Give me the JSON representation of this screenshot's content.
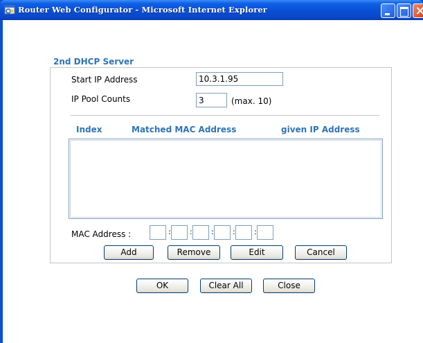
{
  "window": {
    "title": "Router Web Configurator - Microsoft Internet Explorer"
  },
  "section": {
    "title": "2nd DHCP Server"
  },
  "start_ip": {
    "label": "Start IP Address",
    "value": "10.3.1.95"
  },
  "ip_pool": {
    "label": "IP Pool Counts",
    "value": "3",
    "hint": "(max. 10)"
  },
  "table": {
    "columns": [
      "Index",
      "Matched MAC Address",
      "given IP Address"
    ],
    "rows": []
  },
  "mac_address": {
    "label": "MAC Address :",
    "octets": [
      "",
      "",
      "",
      "",
      "",
      ""
    ]
  },
  "buttons": {
    "add": "Add",
    "remove": "Remove",
    "edit": "Edit",
    "cancel": "Cancel",
    "ok": "OK",
    "clear_all": "Clear All",
    "close": "Close"
  },
  "icons": {
    "app": "ie-window-icon",
    "minimize": "minimize-icon",
    "maximize": "maximize-icon",
    "close": "close-icon"
  }
}
